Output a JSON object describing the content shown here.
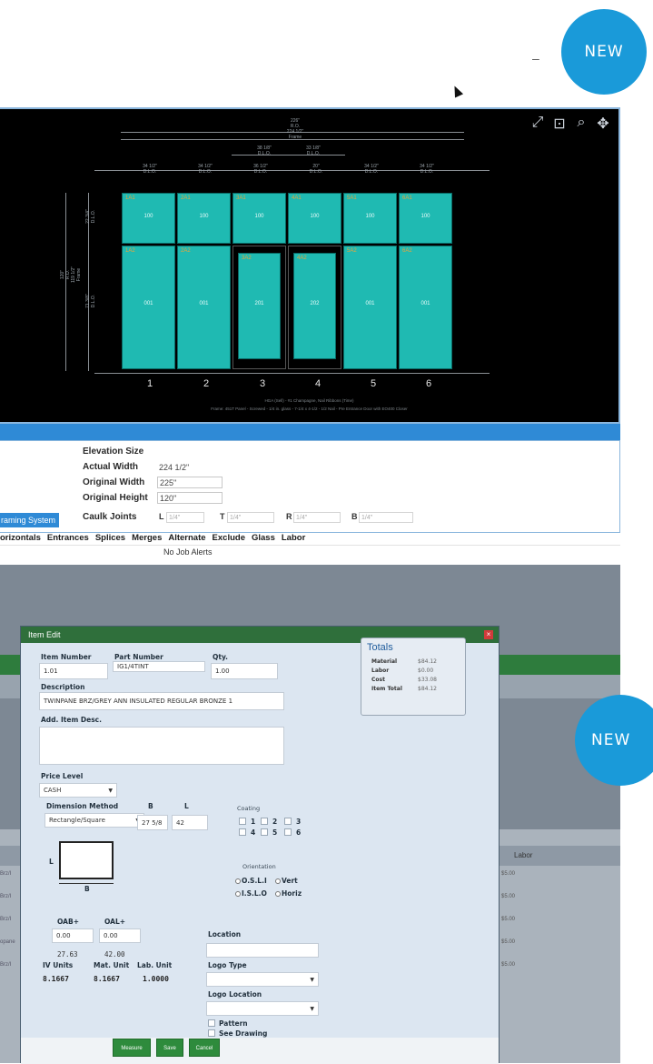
{
  "badges": {
    "top": "NEW",
    "bottom": "NEW"
  },
  "top_window": {
    "minimize": "–",
    "view_tools": [
      "expand-icon",
      "zoom-extents-icon",
      "zoom-icon",
      "pan-icon"
    ],
    "drawing": {
      "overall_width": "226\"\nR.O.\n224 1/2\"\nFrame",
      "top_dims": [
        "34 1/2\"\nD.L.O.",
        "34 1/2\"\nD.L.O.",
        "36 1/2\"\nD.L.O.",
        "20\"\nD.L.O.",
        "34 1/2\"\nD.L.O.",
        "34 1/2\"\nD.L.O."
      ],
      "door_dims": [
        "38 1/8\"\nD.L.O.",
        "33 1/8\"\nD.L.O."
      ],
      "height_dim": "120\"\nR.O.\n119 1/2\"\nFrame",
      "upper_dim": "22 3/4\"\nD.L.O.",
      "lower_dim": "71 3/8\"\nD.L.O.",
      "columns": [
        "1",
        "2",
        "3",
        "4",
        "5",
        "6"
      ],
      "footer1": "HGA (Sell) - #1 Champagne, Nail Ribbons (Time)",
      "footer2": "Frame: 451T Panel - Screwed - 1/4 in. glass - 7-1/4 x 4-1/2 - 1/2 Nail - Pre Entrance Door with EO400 Closer"
    },
    "elevation": {
      "title": "Elevation Size",
      "actual_width_label": "Actual Width",
      "actual_width": "224 1/2\"",
      "original_width_label": "Original Width",
      "original_width": "225\"",
      "original_height_label": "Original Height",
      "original_height": "120\"",
      "caulk_label": "Caulk Joints",
      "caulk": [
        {
          "side": "L",
          "value": "1/4\""
        },
        {
          "side": "T",
          "value": "1/4\""
        },
        {
          "side": "R",
          "value": "1/4\""
        },
        {
          "side": "B",
          "value": "1/4\""
        }
      ],
      "framing_button": "raming System"
    },
    "tabs": [
      "orizontals",
      "Entrances",
      "Splices",
      "Merges",
      "Alternate",
      "Exclude",
      "Glass",
      "Labor"
    ],
    "alerts": "No Job Alerts"
  },
  "item_edit": {
    "title": "Item Edit",
    "close": "×",
    "item_number_label": "Item Number",
    "item_number": "1.01",
    "part_number_label": "Part Number",
    "part_number": "IG1/4TINT",
    "qty_label": "Qty.",
    "qty": "1.00",
    "description_label": "Description",
    "description": "TWINPANE BRZ/GREY ANN INSULATED REGULAR BRONZE 1",
    "add_desc_label": "Add. Item Desc.",
    "add_desc": "",
    "price_level_label": "Price Level",
    "price_level": "CASH",
    "dim_method_label": "Dimension Method",
    "dim_method": "Rectangle/Square",
    "b_label": "B",
    "l_label": "L",
    "b_value": "27 5/8",
    "l_value": "42",
    "coating_label": "Coating",
    "coating_options": [
      "1",
      "2",
      "3",
      "4",
      "5",
      "6"
    ],
    "orientation_label": "Orientation",
    "orientation_options": [
      "O.S.L.I",
      "Vert",
      "I.S.L.O",
      "Horiz"
    ],
    "diagram_l": "L",
    "diagram_b": "B",
    "oab_label": "OAB+",
    "oal_label": "OAL+",
    "oab": "0.00",
    "oal": "0.00",
    "b_total": "27.63",
    "l_total": "42.00",
    "iv_units_label": "IV Units",
    "mat_unit_label": "Mat. Unit",
    "lab_unit_label": "Lab. Unit",
    "iv_units": "8.1667",
    "mat_unit": "8.1667",
    "lab_unit": "1.0000",
    "location_label": "Location",
    "location": "",
    "logo_type_label": "Logo Type",
    "logo_location_label": "Logo Location",
    "pattern_label": "Pattern",
    "see_drawing_label": "See Drawing",
    "totals": {
      "title": "Totals",
      "rows": [
        {
          "label": "Material",
          "value": "$84.12"
        },
        {
          "label": "Labor",
          "value": "$0.00"
        },
        {
          "label": "Cost",
          "value": "$33.08"
        },
        {
          "label": "Item Total",
          "value": "$84.12"
        }
      ]
    },
    "buttons": {
      "measure": "Measure",
      "save": "Save",
      "cancel": "Cancel"
    }
  },
  "background_app": {
    "labor_header": "Labor",
    "labor_values": [
      "$5.00",
      "$5.00",
      "$5.00",
      "$5.00",
      "$5.00"
    ],
    "left_labels": [
      "Brz/I",
      "Brz/I",
      "Brz/I",
      "opane",
      "Brz/I"
    ]
  }
}
